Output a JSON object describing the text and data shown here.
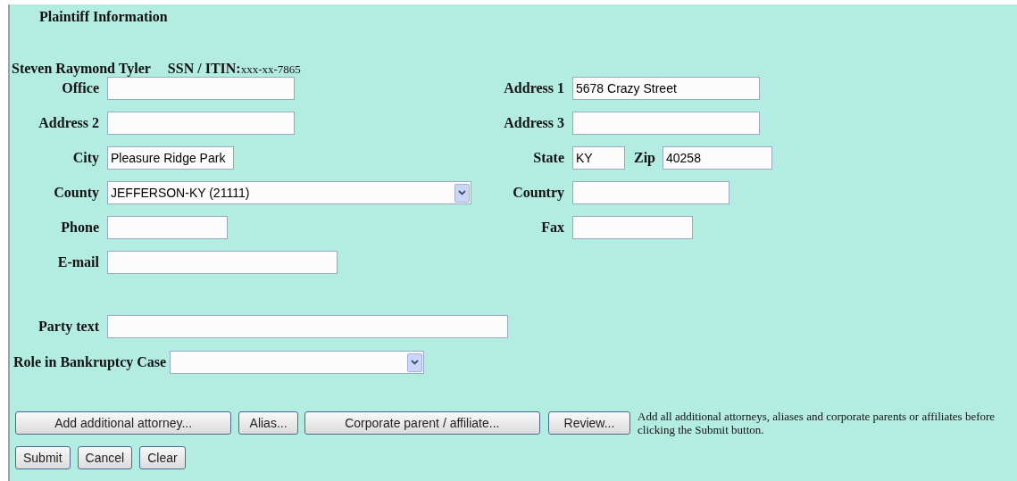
{
  "title": "Plaintiff Information",
  "party": {
    "name": "Steven Raymond Tyler",
    "ssn_label": "SSN / ITIN:",
    "ssn_value": "xxx-xx-7865"
  },
  "rows": [
    {
      "left": [
        {
          "label": "Office",
          "kind": "text"
        }
      ],
      "right": [
        {
          "label": "Address 1",
          "kind": "text",
          "value": "5678 Crazy Street"
        }
      ]
    },
    {
      "left": [
        {
          "label": "Address 2",
          "kind": "text"
        }
      ],
      "right": [
        {
          "label": "Address 3",
          "kind": "text"
        }
      ]
    },
    {
      "left": [
        {
          "label": "City",
          "kind": "text",
          "value": "Pleasure Ridge Park"
        }
      ],
      "right": [
        {
          "label": "State",
          "kind": "text",
          "value": "KY"
        },
        {
          "label": "Zip",
          "kind": "text",
          "value": "40258"
        }
      ]
    },
    {
      "left": [
        {
          "label": "County",
          "kind": "select",
          "value": "JEFFERSON-KY (21111)"
        }
      ],
      "right": [
        {
          "label": "Country",
          "kind": "text"
        }
      ]
    },
    {
      "left": [
        {
          "label": "Phone",
          "kind": "text"
        }
      ],
      "right": [
        {
          "label": "Fax",
          "kind": "text"
        }
      ]
    },
    {
      "left": [
        {
          "label": "E-mail",
          "kind": "text"
        }
      ],
      "right": []
    }
  ],
  "party_text": {
    "label": "Party text",
    "kind": "text"
  },
  "role": {
    "label": "Role in Bankruptcy Case",
    "kind": "select"
  },
  "action_buttons": [
    "Add additional attorney...",
    "Alias...",
    "Corporate parent / affiliate...",
    "Review..."
  ],
  "note": "Add all additional attorneys, aliases and corporate parents or affiliates before clicking the Submit button.",
  "form_buttons": [
    "Submit",
    "Cancel",
    "Clear"
  ]
}
